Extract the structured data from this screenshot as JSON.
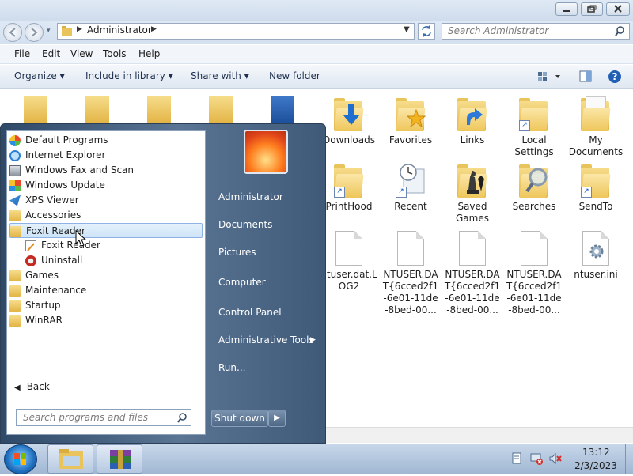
{
  "window": {
    "address": {
      "segment": "Administrator"
    },
    "search_placeholder": "Search Administrator",
    "menu": [
      "File",
      "Edit",
      "View",
      "Tools",
      "Help"
    ],
    "commands": [
      "Organize",
      "Include in library",
      "Share with",
      "New folder"
    ]
  },
  "files": [
    {
      "label": "Downloads",
      "icon": "downloads-folder-icon"
    },
    {
      "label": "Favorites",
      "icon": "favorites-folder-icon"
    },
    {
      "label": "Links",
      "icon": "links-folder-icon"
    },
    {
      "label": "Local\nSettings",
      "icon": "folder-shortcut-icon"
    },
    {
      "label": "My\nDocuments",
      "icon": "folder-icon"
    },
    {
      "label": "PrintHood",
      "icon": "folder-shortcut-icon"
    },
    {
      "label": "Recent",
      "icon": "recent-shortcut-icon"
    },
    {
      "label": "Saved\nGames",
      "icon": "saved-games-folder-icon"
    },
    {
      "label": "Searches",
      "icon": "searches-folder-icon"
    },
    {
      "label": "SendTo",
      "icon": "folder-shortcut-icon"
    },
    {
      "label": "ntuser.dat.L\nOG2",
      "icon": "file-icon"
    },
    {
      "label": "NTUSER.DA\nT{6cced2f1\n-6e01-11de\n-8bed-00...",
      "icon": "file-icon"
    },
    {
      "label": "NTUSER.DA\nT{6cced2f1\n-6e01-11de\n-8bed-00...",
      "icon": "file-icon"
    },
    {
      "label": "NTUSER.DA\nT{6cced2f1\n-6e01-11de\n-8bed-00...",
      "icon": "file-icon"
    },
    {
      "label": "ntuser.ini",
      "icon": "settings-file-icon"
    }
  ],
  "startmenu": {
    "programs": [
      {
        "label": "Default Programs",
        "icon": "default-programs-icon"
      },
      {
        "label": "Internet Explorer",
        "icon": "internet-explorer-icon"
      },
      {
        "label": "Windows Fax and Scan",
        "icon": "fax-scan-icon"
      },
      {
        "label": "Windows Update",
        "icon": "windows-update-icon"
      },
      {
        "label": "XPS Viewer",
        "icon": "xps-viewer-icon"
      },
      {
        "label": "Accessories",
        "icon": "folder-icon"
      },
      {
        "label": "Foxit Reader",
        "icon": "folder-icon"
      },
      {
        "label": "Foxit Reader",
        "icon": "foxit-reader-icon"
      },
      {
        "label": "Uninstall",
        "icon": "uninstall-icon"
      },
      {
        "label": "Games",
        "icon": "folder-icon"
      },
      {
        "label": "Maintenance",
        "icon": "folder-icon"
      },
      {
        "label": "Startup",
        "icon": "folder-icon"
      },
      {
        "label": "WinRAR",
        "icon": "folder-icon"
      }
    ],
    "back_label": "Back",
    "search_placeholder": "Search programs and files",
    "right_links": [
      "Administrator",
      "Documents",
      "Pictures",
      "Computer",
      "Control Panel",
      "Administrative Tools",
      "Run..."
    ],
    "shutdown_label": "Shut down"
  },
  "taskbar": {
    "time": "13:12",
    "date": "2/3/2023"
  },
  "colors": {
    "startmenu_dark": "#2f4a68",
    "highlight": "#cde4f7",
    "taskbar": "#b6c9e1"
  }
}
